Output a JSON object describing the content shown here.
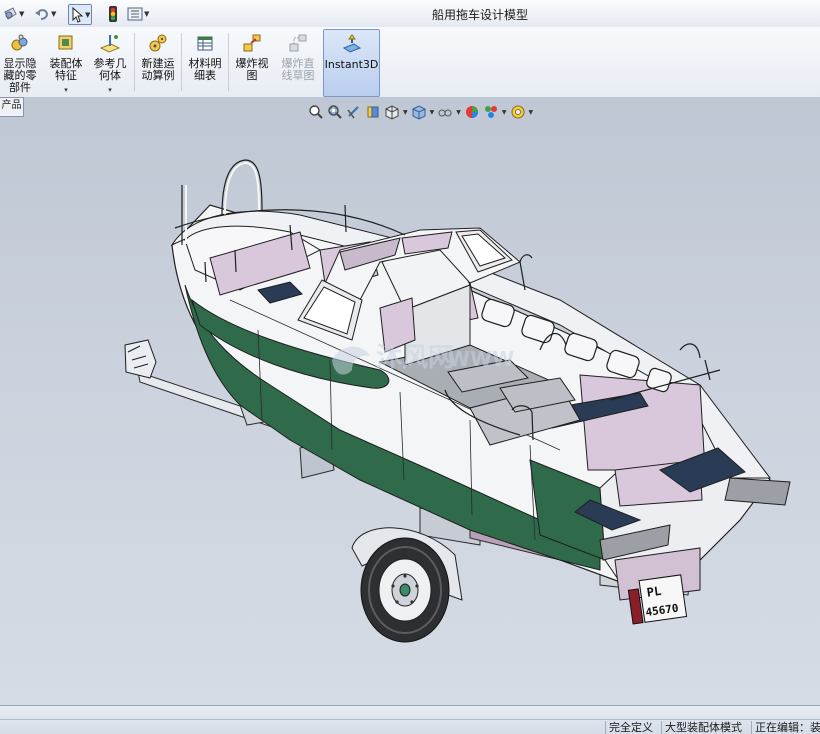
{
  "window": {
    "title": "船用拖车设计模型"
  },
  "quick_access": {
    "icons": [
      "new-document-icon",
      "undo-icon",
      "select-arrow-icon",
      "rebuild-traffic-light-icon",
      "options-icon"
    ]
  },
  "ribbon": {
    "buttons": [
      {
        "id": "show-hidden-components",
        "label": "显示隐\n藏的零\n部件",
        "icon": "show-hidden-icon"
      },
      {
        "id": "assembly-features",
        "label": "装配体\n特征",
        "icon": "assembly-feature-icon",
        "dropdown": "▾"
      },
      {
        "id": "reference-geometry",
        "label": "参考几\n何体",
        "icon": "reference-geometry-icon",
        "dropdown": "▾"
      },
      {
        "id": "new-motion-study",
        "label": "新建运\n动算例",
        "icon": "motion-study-icon"
      },
      {
        "id": "bill-of-materials",
        "label": "材料明\n细表",
        "icon": "bom-icon"
      },
      {
        "id": "exploded-view",
        "label": "爆炸视\n图",
        "icon": "exploded-view-icon"
      },
      {
        "id": "explode-line-sketch",
        "label": "爆炸直\n线草图",
        "icon": "explode-line-icon",
        "disabled": true
      },
      {
        "id": "instant3d",
        "label": "Instant3D",
        "icon": "instant3d-icon",
        "active": true
      }
    ]
  },
  "feature_manager": {
    "tab_label": "产品"
  },
  "heads_up_toolbar": {
    "icons": [
      "zoom-to-fit-icon",
      "zoom-area-icon",
      "previous-view-icon",
      "section-view-icon",
      "view-orientation-icon",
      "display-style-icon",
      "hide-show-items-icon",
      "edit-appearance-icon",
      "apply-scene-icon",
      "view-settings-icon"
    ]
  },
  "viewport": {
    "watermark": "沐风网",
    "watermark_url": "WWW",
    "license_plate": {
      "line1": "PL",
      "line2": "45670"
    }
  },
  "status_bar": {
    "cells": [
      "完全定义",
      "大型装配体模式",
      "正在编辑：装"
    ]
  },
  "colors": {
    "hull_white": "#f4f5f7",
    "hull_green": "#2f6b4a",
    "interior_lavender": "#d9c8dc",
    "cushion_navy": "#2a3b55",
    "tire_dark": "#2d2f33"
  }
}
